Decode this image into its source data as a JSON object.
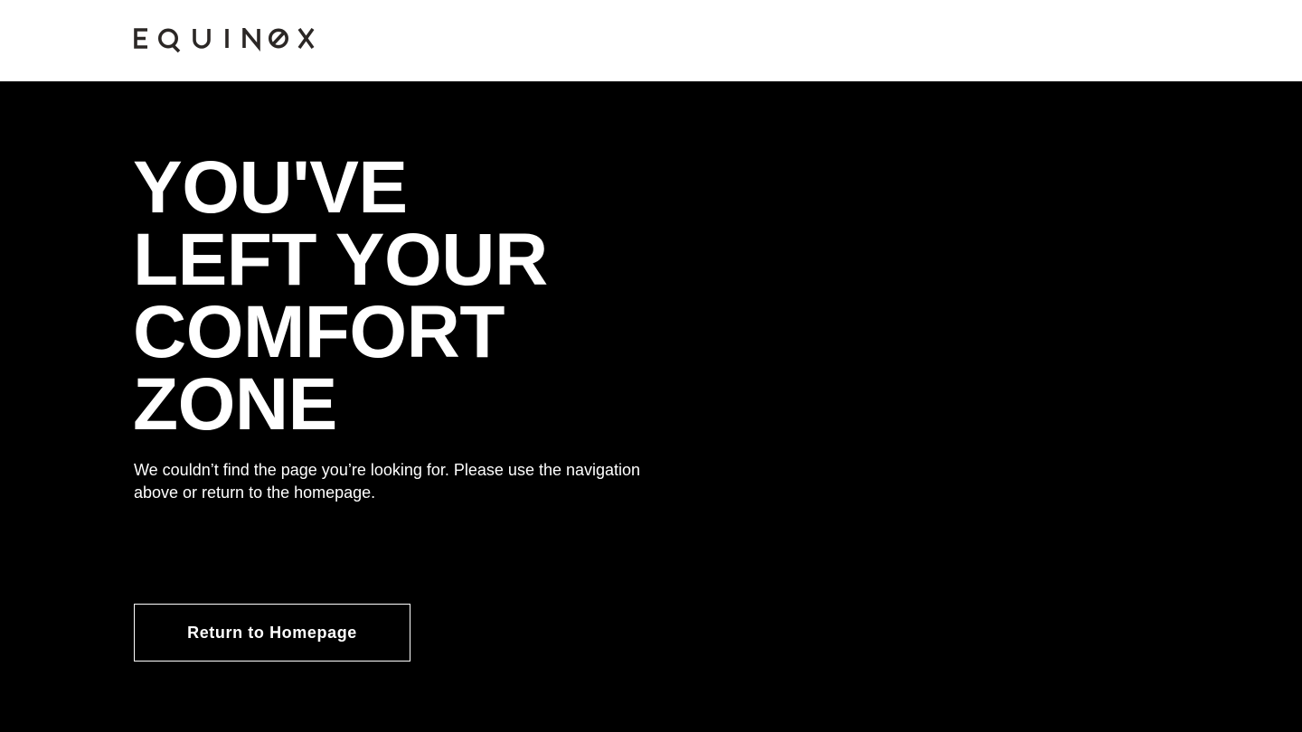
{
  "header": {
    "logo_text": "EQUINOX",
    "logo_color": "#2b2725",
    "background": "#ffffff"
  },
  "main": {
    "background": "#000000",
    "headline_lines": [
      "YOU'VE",
      "LEFT YOUR",
      "COMFORT",
      "ZONE"
    ],
    "message": "We couldn’t find the page you’re looking for. Please use the navigation above or return to the homepage.",
    "return_button_label": "Return to Homepage"
  }
}
